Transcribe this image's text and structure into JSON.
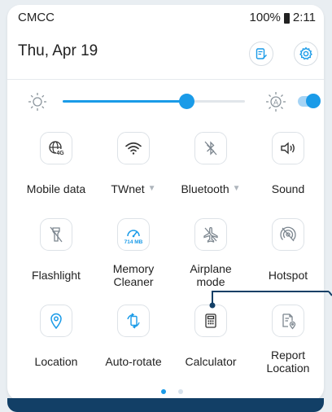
{
  "status": {
    "carrier": "CMCC",
    "battery": "100%",
    "time": "2:11"
  },
  "date": "Thu, Apr 19",
  "brightness": {
    "level": 0.68,
    "auto": true
  },
  "tiles": [
    {
      "label": "Mobile data",
      "caret": "",
      "icon": "mobile-data-4g-icon"
    },
    {
      "label": "TWnet",
      "caret": "▼",
      "icon": "wifi-icon"
    },
    {
      "label": "Bluetooth",
      "caret": "▼",
      "icon": "bluetooth-off-icon"
    },
    {
      "label": "Sound",
      "caret": "",
      "icon": "speaker-icon"
    },
    {
      "label": "Flashlight",
      "caret": "",
      "icon": "flashlight-off-icon"
    },
    {
      "label": "Memory\nCleaner",
      "caret": "",
      "icon": "speedometer-icon",
      "badge": "714 MB"
    },
    {
      "label": "Airplane\nmode",
      "caret": "",
      "icon": "airplane-off-icon"
    },
    {
      "label": "Hotspot",
      "caret": "",
      "icon": "hotspot-off-icon"
    },
    {
      "label": "Location",
      "caret": "",
      "icon": "location-pin-icon"
    },
    {
      "label": "Auto-rotate",
      "caret": "",
      "icon": "auto-rotate-icon"
    },
    {
      "label": "Calculator",
      "caret": "",
      "icon": "calculator-icon"
    },
    {
      "label": "Report\nLocation",
      "caret": "",
      "icon": "report-location-icon"
    }
  ],
  "page": {
    "current": 1,
    "total": 2
  },
  "accent": "#1a9be8"
}
